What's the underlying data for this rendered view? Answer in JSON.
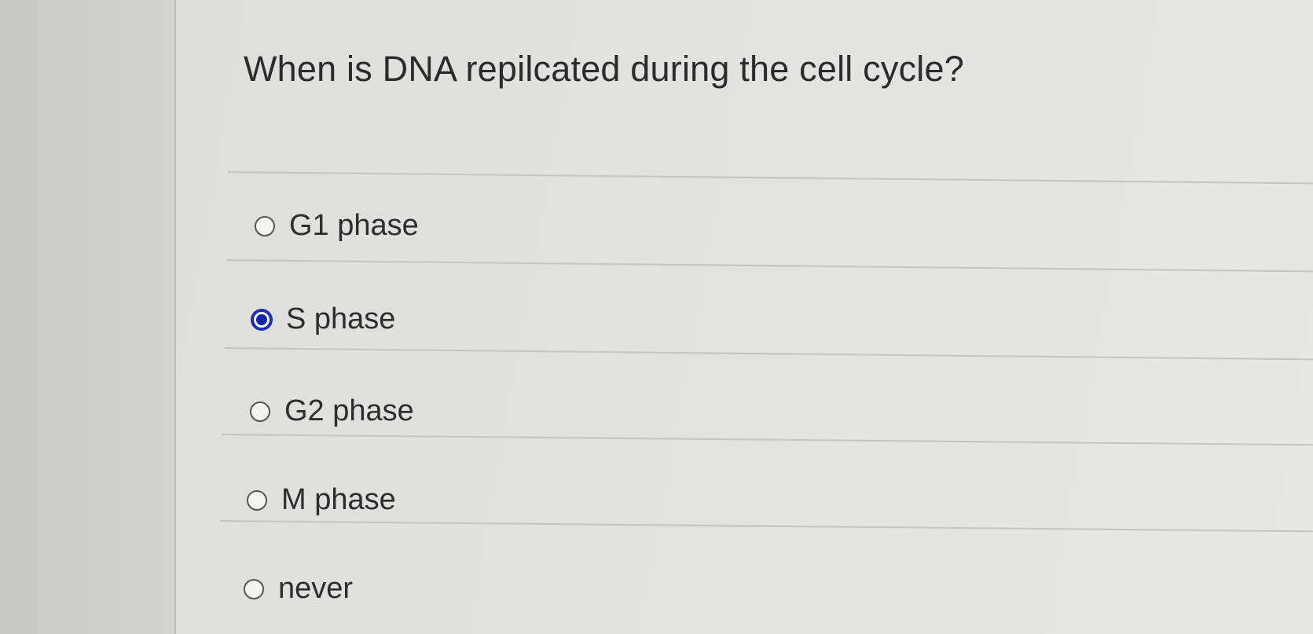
{
  "question": {
    "text": "When is DNA repilcated during the cell cycle?"
  },
  "answers": [
    {
      "label": "G1 phase",
      "selected": false
    },
    {
      "label": "S phase",
      "selected": true
    },
    {
      "label": "G2 phase",
      "selected": false
    },
    {
      "label": "M phase",
      "selected": false
    },
    {
      "label": "never",
      "selected": false
    }
  ],
  "colors": {
    "selected_radio": "#1c2fb3",
    "text": "#2d2d2d",
    "background": "#e2e2e0"
  }
}
